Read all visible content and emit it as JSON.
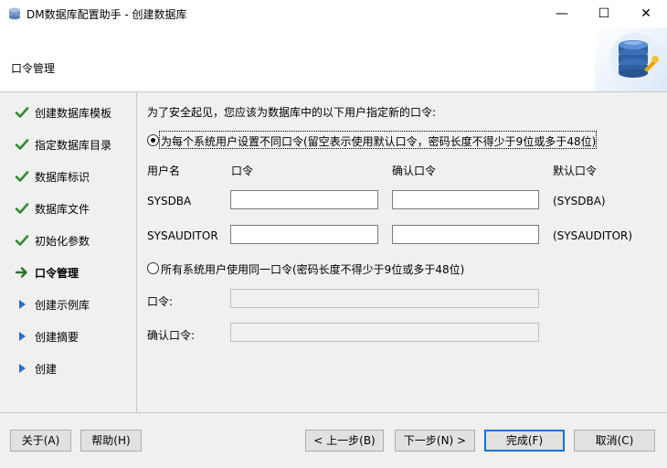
{
  "window": {
    "title": "DM数据库配置助手 - 创建数据库",
    "minimize_glyph": "—",
    "maximize_glyph": "☐",
    "close_glyph": "✕"
  },
  "header": {
    "title": "口令管理",
    "logo_icon": "database-gear-icon"
  },
  "steps": [
    {
      "label": "创建数据库模板",
      "status": "done",
      "icon": "checkmark-icon"
    },
    {
      "label": "指定数据库目录",
      "status": "done",
      "icon": "checkmark-icon"
    },
    {
      "label": "数据库标识",
      "status": "done",
      "icon": "checkmark-icon"
    },
    {
      "label": "数据库文件",
      "status": "done",
      "icon": "checkmark-icon"
    },
    {
      "label": "初始化参数",
      "status": "done",
      "icon": "checkmark-icon"
    },
    {
      "label": "口令管理",
      "status": "current",
      "icon": "arrow-right-icon"
    },
    {
      "label": "创建示例库",
      "status": "pending",
      "icon": "triangle-right-icon"
    },
    {
      "label": "创建摘要",
      "status": "pending",
      "icon": "triangle-right-icon"
    },
    {
      "label": "创建",
      "status": "pending",
      "icon": "triangle-right-icon"
    }
  ],
  "content": {
    "intro": "为了安全起见，您应该为数据库中的以下用户指定新的口令:",
    "option_individual": {
      "label": "为每个系统用户设置不同口令(留空表示使用默认口令，密码长度不得少于9位或多于48位)",
      "selected": true
    },
    "columns": {
      "username": "用户名",
      "password": "口令",
      "confirm": "确认口令",
      "default": "默认口令"
    },
    "users": [
      {
        "name": "SYSDBA",
        "password": "",
        "confirm": "",
        "default": "(SYSDBA)"
      },
      {
        "name": "SYSAUDITOR",
        "password": "",
        "confirm": "",
        "default": "(SYSAUDITOR)"
      }
    ],
    "option_same": {
      "label": "所有系统用户使用同一口令(密码长度不得少于9位或多于48位)",
      "selected": false
    },
    "same_password_label": "口令:",
    "same_confirm_label": "确认口令:",
    "same_password_value": "",
    "same_confirm_value": ""
  },
  "footer": {
    "about": "关于(A)",
    "help": "帮助(H)",
    "prev": "< 上一步(B)",
    "next": "下一步(N) >",
    "finish": "完成(F)",
    "cancel": "取消(C)"
  },
  "colors": {
    "check_green": "#2e8b2e",
    "current_arrow": "#2f6f2f",
    "pending_blue": "#2b6cc4",
    "default_button_border": "#0078d7"
  }
}
